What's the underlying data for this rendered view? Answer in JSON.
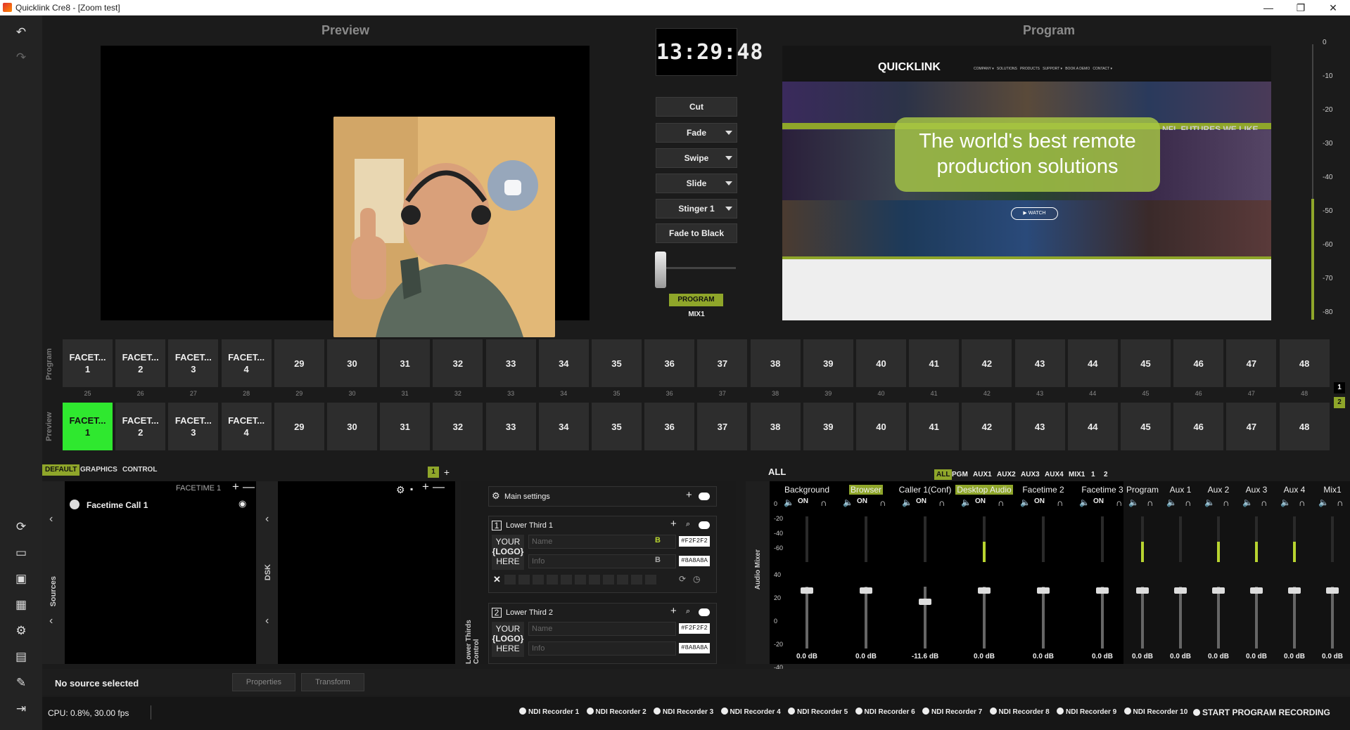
{
  "window": {
    "title": "Quicklink Cre8 - [Zoom test]",
    "controls": [
      "—",
      "❐",
      "✕"
    ]
  },
  "toolbar": {
    "undo_icon": "↶",
    "redo_icon": "↷"
  },
  "preview": {
    "header": "Preview"
  },
  "program": {
    "header": "Program",
    "overlay_line1": "The world's best remote",
    "overlay_line2": "production solutions",
    "site_logo": "QUICKLINK",
    "site_menu": "COMPANY ▾   SOLUTIONS   PRODUCTS   SUPPORT ▾   BOOK A DEMO   CONTACT ▾",
    "banner": "NFL FUTURES WE LIKE",
    "watch": "▶ WATCH"
  },
  "clock": {
    "time": "13:29:48"
  },
  "transitions": {
    "cut": "Cut",
    "fade": "Fade",
    "swipe": "Swipe",
    "slide": "Slide",
    "stinger": "Stinger 1",
    "ftb": "Fade to Black",
    "program_label": "PROGRAM",
    "mix_label": "MIX1"
  },
  "meter": {
    "ticks": [
      "0",
      "-10",
      "-20",
      "-30",
      "-40",
      "-50",
      "-60",
      "-70",
      "-80"
    ],
    "level": 0.44
  },
  "buses": {
    "program_label": "Program",
    "preview_label": "Preview",
    "page1": "1",
    "page2": "2"
  },
  "sources": [
    "FACET...\n1",
    "FACET...\n2",
    "FACET...\n3",
    "FACET...\n4",
    "29",
    "30",
    "31",
    "32",
    "33",
    "34",
    "35",
    "36",
    "37",
    "38",
    "39",
    "40",
    "41",
    "42",
    "43",
    "44",
    "45",
    "46",
    "47",
    "48"
  ],
  "source_numbers": [
    "25",
    "26",
    "27",
    "28",
    "29",
    "30",
    "31",
    "32",
    "33",
    "34",
    "35",
    "36",
    "37",
    "38",
    "39",
    "40",
    "41",
    "42",
    "43",
    "44",
    "45",
    "46",
    "47",
    "48"
  ],
  "bottom_tabs": {
    "default": "DEFAULT",
    "graphics": "GRAPHICS",
    "control": "CONTROL",
    "scene_num": "1",
    "add": "+"
  },
  "sources_panel": {
    "label": "Sources",
    "scene": "FACETIME 1",
    "item": "Facetime Call 1",
    "chevron": "‹"
  },
  "dsk_panel": {
    "label": "DSK"
  },
  "lower_thirds": {
    "label": "Lower Thirds Control",
    "main": "Main settings",
    "lt1": "Lower Third 1",
    "lt2": "Lower Third 2",
    "name_ph": "Name",
    "info_ph": "Info",
    "logo1": "YOUR",
    "logo2": "{LOGO}",
    "logo3": "HERE",
    "color1": "#F2F2F2",
    "color2": "#8A8A8A"
  },
  "audio": {
    "label": "Audio Mixer",
    "all": "ALL",
    "filters": [
      "ALL",
      "PGM",
      "AUX1",
      "AUX2",
      "AUX3",
      "AUX4",
      "MIX1",
      "1",
      "2"
    ],
    "channels": [
      {
        "name": "Background",
        "on": "ON",
        "db": "0.0 dB",
        "level": 0
      },
      {
        "name": "Browser",
        "on": "ON",
        "db": "0.0 dB",
        "level": 0,
        "highlight": true
      },
      {
        "name": "Caller 1(Conf)",
        "on": "ON",
        "db": "-11.6 dB",
        "level": 0
      },
      {
        "name": "Desktop Audio",
        "on": "ON",
        "db": "0.0 dB",
        "level": 0.45,
        "highlight": true
      },
      {
        "name": "Facetime 2",
        "on": "ON",
        "db": "0.0 dB",
        "level": 0
      },
      {
        "name": "Facetime 3",
        "on": "ON",
        "db": "0.0 dB",
        "level": 0
      }
    ],
    "outputs": [
      {
        "name": "Program",
        "db": "0.0 dB",
        "level": 0.45
      },
      {
        "name": "Aux 1",
        "db": "0.0 dB",
        "level": 0
      },
      {
        "name": "Aux 2",
        "db": "0.0 dB",
        "level": 0.45
      },
      {
        "name": "Aux 3",
        "db": "0.0 dB",
        "level": 0.45
      },
      {
        "name": "Aux 4",
        "db": "0.0 dB",
        "level": 0.45
      },
      {
        "name": "Mix1",
        "db": "0.0 dB",
        "level": 0
      }
    ],
    "scale_top": [
      "0",
      "-20",
      "-40",
      "-60"
    ],
    "scale_bot": [
      "40",
      "20",
      "0",
      "-20",
      "-40"
    ]
  },
  "status": {
    "no_source": "No source selected",
    "properties": "Properties",
    "transform": "Transform",
    "cpu": "CPU: 0.8%, 30.00 fps",
    "ndi": [
      "NDI Recorder 1",
      "NDI Recorder 2",
      "NDI Recorder 3",
      "NDI Recorder 4",
      "NDI Recorder 5",
      "NDI Recorder 6",
      "NDI Recorder 7",
      "NDI Recorder 8",
      "NDI Recorder 9",
      "NDI Recorder 10"
    ],
    "start_rec": "START PROGRAM RECORDING"
  }
}
